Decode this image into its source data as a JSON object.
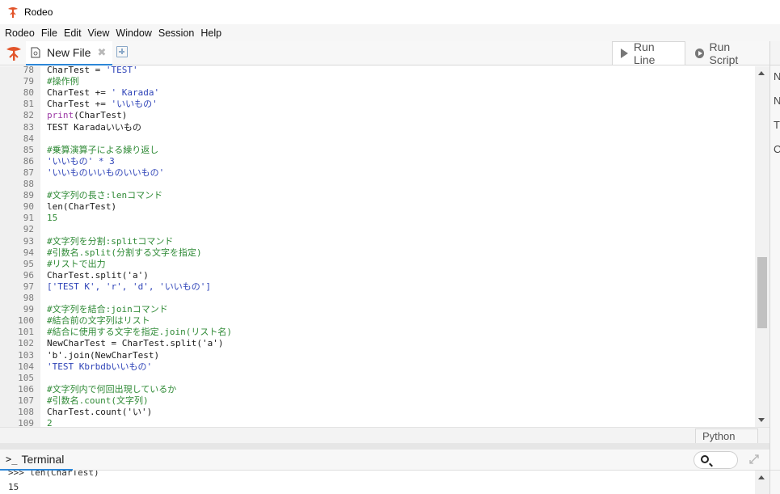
{
  "window": {
    "title": "Rodeo"
  },
  "menu": [
    "Rodeo",
    "File",
    "Edit",
    "View",
    "Window",
    "Session",
    "Help"
  ],
  "editor": {
    "tab_label": "New File",
    "run_line_label": "Run Line",
    "run_script_label": "Run Script",
    "language": "Python",
    "scroll_thumb_fraction_start": 0.53,
    "scroll_thumb_fraction_size": 0.21,
    "lines": [
      {
        "num": "78",
        "text": "CharTest = 'TEST'",
        "kind": "mixed_assign"
      },
      {
        "num": "79",
        "text": "#操作例",
        "kind": "comment"
      },
      {
        "num": "80",
        "text": "CharTest += ' Karada'",
        "kind": "mixed_assign"
      },
      {
        "num": "81",
        "text": "CharTest += 'いいもの'",
        "kind": "mixed_assign"
      },
      {
        "num": "82",
        "text": "print(CharTest)",
        "kind": "print"
      },
      {
        "num": "83",
        "text": "TEST Karadaいいもの",
        "kind": "plain"
      },
      {
        "num": "84",
        "text": "",
        "kind": "plain"
      },
      {
        "num": "85",
        "text": "#乗算演算子による繰り返し",
        "kind": "comment"
      },
      {
        "num": "86",
        "text": "'いいもの' * 3",
        "kind": "string"
      },
      {
        "num": "87",
        "text": "'いいものいいものいいもの'",
        "kind": "string"
      },
      {
        "num": "88",
        "text": "",
        "kind": "plain"
      },
      {
        "num": "89",
        "text": "#文字列の長さ:lenコマンド",
        "kind": "comment"
      },
      {
        "num": "90",
        "text": "len(CharTest)",
        "kind": "plain"
      },
      {
        "num": "91",
        "text": "15",
        "kind": "number"
      },
      {
        "num": "92",
        "text": "",
        "kind": "plain"
      },
      {
        "num": "93",
        "text": "#文字列を分割:splitコマンド",
        "kind": "comment"
      },
      {
        "num": "94",
        "text": "#引数名.split(分割する文字を指定)",
        "kind": "comment"
      },
      {
        "num": "95",
        "text": "#リストで出力",
        "kind": "comment"
      },
      {
        "num": "96",
        "text": "CharTest.split('a')",
        "kind": "plain"
      },
      {
        "num": "97",
        "text": "['TEST K', 'r', 'd', 'いいもの']",
        "kind": "string"
      },
      {
        "num": "98",
        "text": "",
        "kind": "plain"
      },
      {
        "num": "99",
        "text": "#文字列を結合:joinコマンド",
        "kind": "comment"
      },
      {
        "num": "100",
        "text": "#結合前の文字列はリスト",
        "kind": "comment"
      },
      {
        "num": "101",
        "text": "#結合に使用する文字を指定.join(リスト名)",
        "kind": "comment"
      },
      {
        "num": "102",
        "text": "NewCharTest = CharTest.split('a')",
        "kind": "plain"
      },
      {
        "num": "103",
        "text": "'b'.join(NewCharTest)",
        "kind": "plain"
      },
      {
        "num": "104",
        "text": "'TEST Kbrbdbいいもの'",
        "kind": "string"
      },
      {
        "num": "105",
        "text": "",
        "kind": "plain"
      },
      {
        "num": "106",
        "text": "#文字列内で何回出現しているか",
        "kind": "comment"
      },
      {
        "num": "107",
        "text": "#引数名.count(文字列)",
        "kind": "comment"
      },
      {
        "num": "108",
        "text": "CharTest.count('い')",
        "kind": "plain"
      },
      {
        "num": "109",
        "text": "2",
        "kind": "number"
      }
    ]
  },
  "terminal": {
    "tab_label": "Terminal",
    "prompt_icon": ">_",
    "lines": [
      ">>> len(CharTest)",
      "15"
    ]
  },
  "right_panel": {
    "rows": [
      "N",
      "N",
      "T",
      "C"
    ]
  },
  "colors": {
    "accent": "#2d87d8",
    "comment": "#2f8a36",
    "string": "#2f44b8"
  }
}
